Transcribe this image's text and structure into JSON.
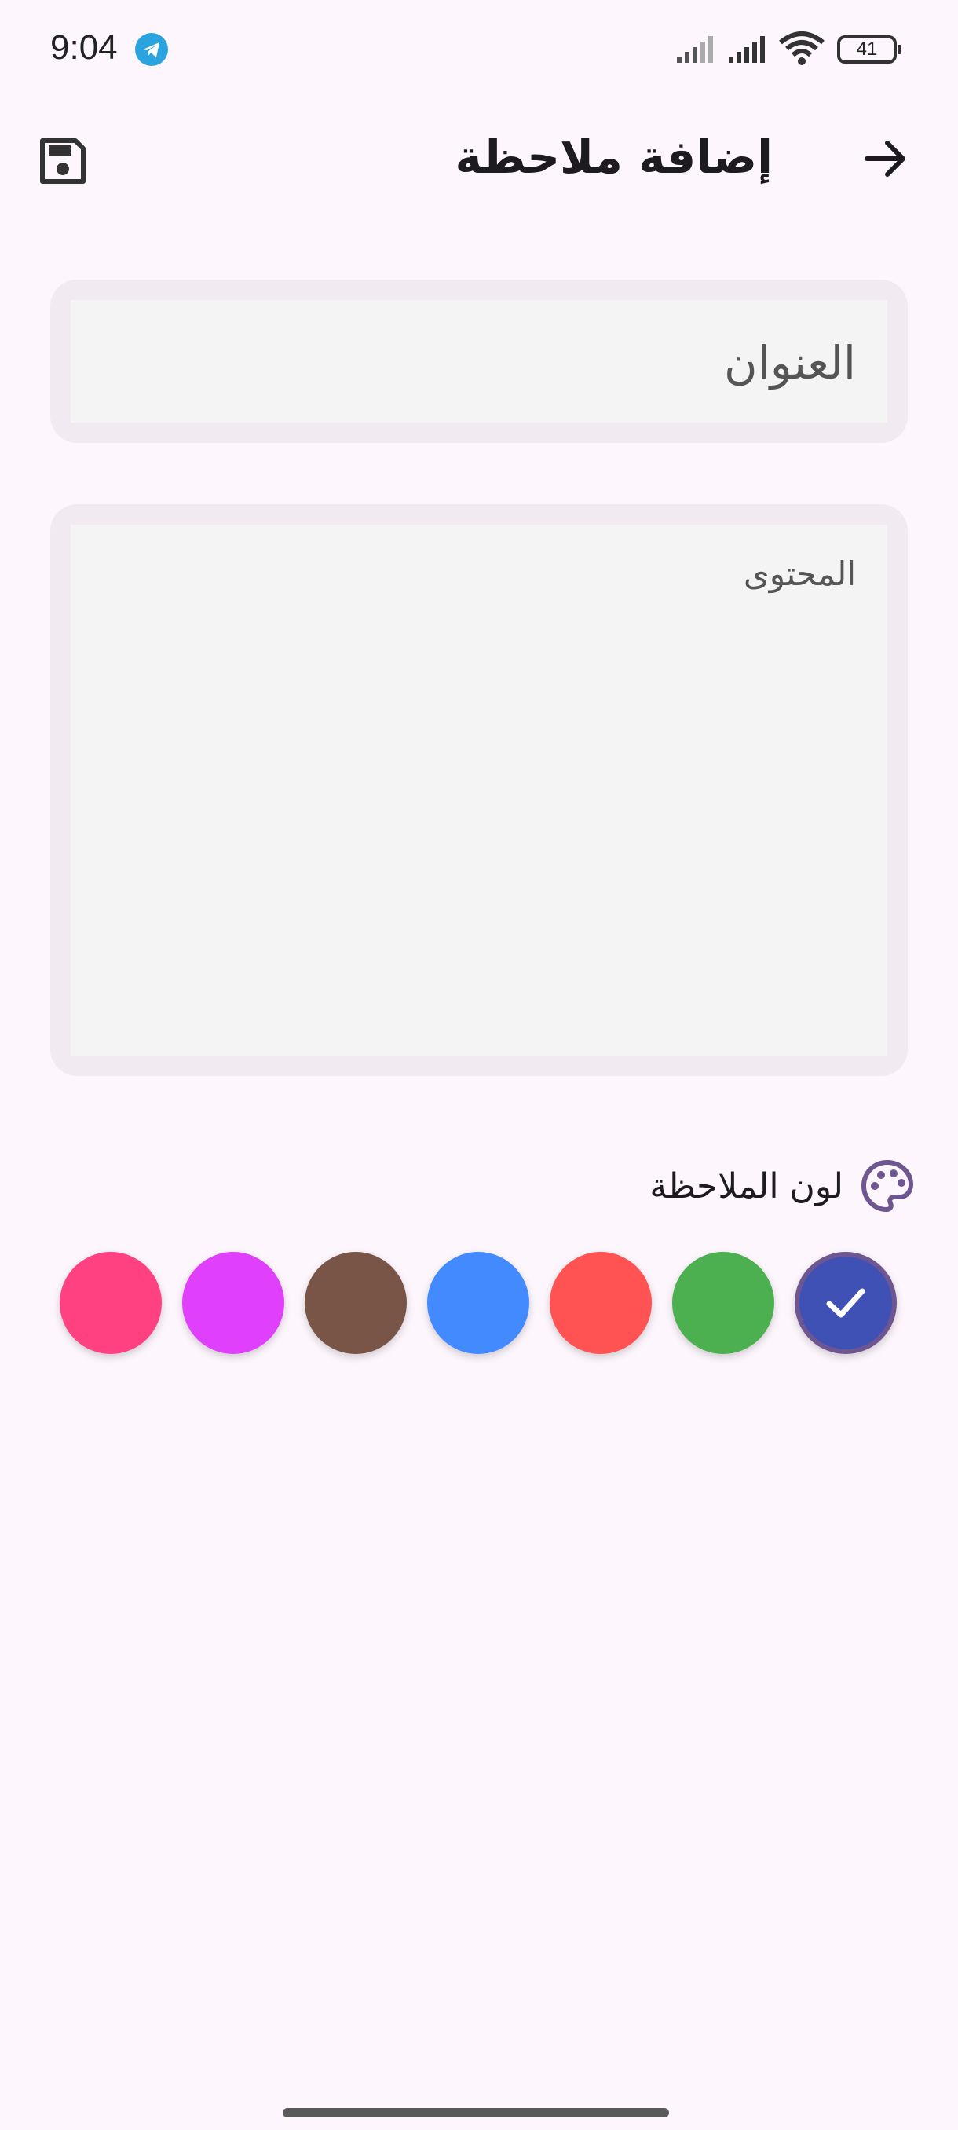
{
  "status_bar": {
    "time": "9:04",
    "battery_level": "41",
    "icons": [
      "telegram-icon",
      "signal-icon",
      "signal-icon",
      "wifi-icon",
      "battery-icon"
    ]
  },
  "app_bar": {
    "title": "إضافة ملاحظة",
    "save_icon": "save-icon",
    "back_icon": "arrow-forward-icon"
  },
  "form": {
    "title_placeholder": "العنوان",
    "content_placeholder": "المحتوى"
  },
  "color_section": {
    "label": "لون الملاحظة",
    "icon": "palette-icon",
    "selected_index": 6,
    "colors": [
      "#ff4081",
      "#e040fb",
      "#795548",
      "#448aff",
      "#ff5252",
      "#4caf50",
      "#3f51b5"
    ]
  },
  "colors": {
    "background": "#fdf6fd",
    "field_frame": "#f1eaf1",
    "field_fill": "#f4f4f4",
    "accent": "#6e5690"
  }
}
